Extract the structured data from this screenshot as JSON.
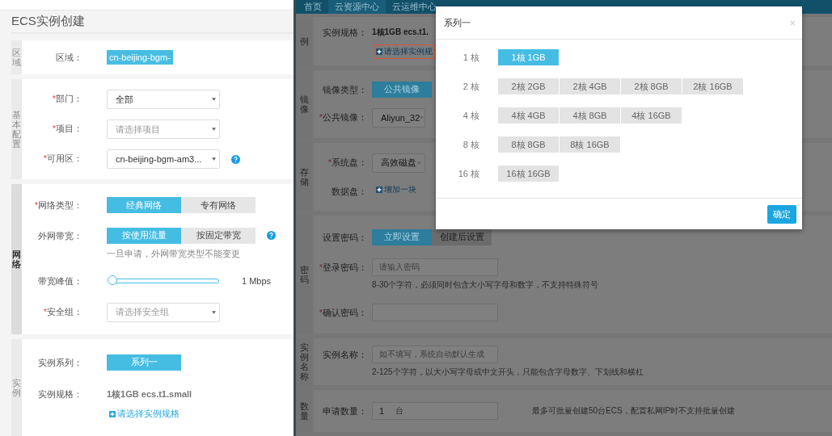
{
  "form": {
    "title": "ECS实例创建",
    "sections": [
      {
        "label": "区域",
        "active": false,
        "rows": [
          {
            "kind": "tag",
            "label": "区域：",
            "value": "cn-beijing-bgm-"
          }
        ]
      },
      {
        "label": "基本配置",
        "active": false,
        "rows": [
          {
            "kind": "select",
            "required_mark": "*",
            "label": "部门：",
            "value": "全部"
          },
          {
            "kind": "select",
            "required_mark": "*",
            "label": "项目：",
            "placeholder": "请选择项目"
          },
          {
            "kind": "select",
            "required_mark": "*",
            "label": "可用区：",
            "value": "cn-beijing-bgm-am3...",
            "help": true
          }
        ]
      },
      {
        "label": "网络",
        "active": true,
        "rows": [
          {
            "kind": "segmented",
            "required_mark": "*",
            "label": "网络类型：",
            "options": [
              {
                "label": "经典网络",
                "selected": true
              },
              {
                "label": "专有网络",
                "selected": false
              }
            ]
          },
          {
            "kind": "segmented",
            "label": "外网带宽：",
            "options": [
              {
                "label": "按使用流量",
                "selected": true
              },
              {
                "label": "按固定带宽",
                "selected": false
              }
            ],
            "help": true,
            "hint": "一旦申请，外网带宽类型不能变更"
          },
          {
            "kind": "slider",
            "label": "带宽峰值：",
            "level": 0,
            "reading": "1 Mbps"
          },
          {
            "kind": "select",
            "required_mark": "*",
            "label": "安全组：",
            "placeholder": "请选择安全组"
          }
        ]
      },
      {
        "label": "实例",
        "active": false,
        "rows": [
          {
            "kind": "segmented",
            "label": "实例系列：",
            "options": [
              {
                "label": "系列一",
                "selected": true
              }
            ]
          },
          {
            "kind": "text",
            "label": "实例规格：",
            "value": "1核1GB ecs.t1.small",
            "link": "请选择实例规格",
            "highlighted": false
          }
        ]
      }
    ]
  },
  "background_page": {
    "nav": [
      {
        "label": "首页",
        "selected": false
      },
      {
        "label": "云资源中心",
        "selected": true
      },
      {
        "label": "云运维中心",
        "selected": false
      }
    ],
    "sections": [
      {
        "label": "例",
        "active": false,
        "rows": [
          {
            "kind": "text",
            "label": "实例规格：",
            "value": "1核1GB ecs.t1.",
            "link": "请选择实例规",
            "highlighted": true
          }
        ]
      },
      {
        "label": "镜像",
        "active": false,
        "rows": [
          {
            "kind": "segmented",
            "label": "镜像类型：",
            "options": [
              {
                "label": "公共镜像",
                "selected": true
              }
            ]
          },
          {
            "kind": "select",
            "required_mark": "*",
            "label": "公共镜像：",
            "value": "Aliyun_32"
          }
        ]
      },
      {
        "label": "存储",
        "active": false,
        "rows": [
          {
            "kind": "select",
            "required_mark": "*",
            "label": "系统盘：",
            "value": "高效磁盘"
          },
          {
            "kind": "link",
            "label": "数据盘：",
            "link": "增加一块"
          }
        ]
      },
      {
        "label": "密码",
        "active": false,
        "rows": [
          {
            "kind": "segmented",
            "label": "设置密码：",
            "options": [
              {
                "label": "立即设置",
                "selected": true
              },
              {
                "label": "创建后设置",
                "selected": false
              }
            ]
          },
          {
            "kind": "input",
            "required_mark": "*",
            "label": "登录密码：",
            "placeholder": "请输入密码",
            "hint": "8-30个字符，必须同时包含大小写字母和数字，不支持特殊符号"
          },
          {
            "kind": "input",
            "required_mark": "*",
            "label": "确认密码："
          }
        ]
      },
      {
        "label": "实例名称",
        "active": false,
        "rows": [
          {
            "kind": "input",
            "label": "实例名称：",
            "placeholder": "如不填写，系统自动默认生成",
            "hint": "2-125个字符，以大小写字母或中文开头，只能包含字母数字、下划线和横杠"
          }
        ]
      },
      {
        "label": "数量",
        "active": false,
        "rows": [
          {
            "kind": "input",
            "label": "申请数量：",
            "value": "1",
            "unit": "台",
            "note": "最多可批量创建50台ECS，配置私网IP时不支持批量创建"
          }
        ]
      }
    ]
  },
  "modal": {
    "title": "系列一",
    "close": "×",
    "confirm": "确定",
    "rows": [
      {
        "label": "1 核",
        "options": [
          {
            "label": "1核 1GB",
            "selected": true
          }
        ]
      },
      {
        "label": "2 核",
        "options": [
          {
            "label": "2核 2GB",
            "selected": false
          },
          {
            "label": "2核 4GB",
            "selected": false
          },
          {
            "label": "2核 8GB",
            "selected": false
          },
          {
            "label": "2核 16GB",
            "selected": false
          }
        ]
      },
      {
        "label": "4 核",
        "options": [
          {
            "label": "4核 4GB",
            "selected": false
          },
          {
            "label": "4核 8GB",
            "selected": false
          },
          {
            "label": "4核 16GB",
            "selected": false
          }
        ]
      },
      {
        "label": "8 核",
        "options": [
          {
            "label": "8核 8GB",
            "selected": false
          },
          {
            "label": "8核 16GB",
            "selected": false
          }
        ]
      },
      {
        "label": "16 核",
        "options": [
          {
            "label": "16核 16GB",
            "selected": false
          }
        ]
      }
    ]
  }
}
